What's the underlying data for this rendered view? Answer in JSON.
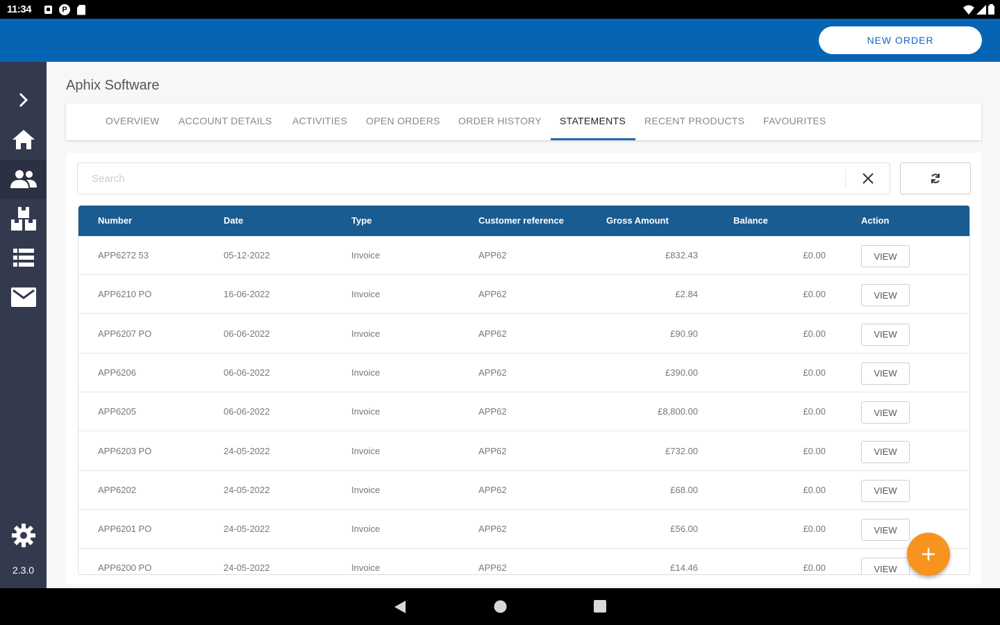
{
  "status_bar": {
    "time": "11:34",
    "notif_letter": "P"
  },
  "header": {
    "new_order_label": "NEW ORDER"
  },
  "sidebar": {
    "items": [
      {
        "name": "expand",
        "icon": "chevron-right-icon"
      },
      {
        "name": "home",
        "icon": "home-icon"
      },
      {
        "name": "customers",
        "icon": "people-icon",
        "active": true
      },
      {
        "name": "products",
        "icon": "boxes-icon"
      },
      {
        "name": "orders",
        "icon": "list-icon"
      },
      {
        "name": "messages",
        "icon": "mail-icon"
      },
      {
        "name": "settings",
        "icon": "gear-icon"
      }
    ],
    "version": "2.3.0"
  },
  "company_name": "Aphix Software",
  "tabs": [
    "OVERVIEW",
    "ACCOUNT DETAILS",
    "ACTIVITIES",
    "OPEN ORDERS",
    "ORDER HISTORY",
    "STATEMENTS",
    "RECENT PRODUCTS",
    "FAVOURITES"
  ],
  "active_tab": "STATEMENTS",
  "search": {
    "placeholder": "Search",
    "value": ""
  },
  "table": {
    "columns": [
      "Number",
      "Date",
      "Type",
      "Customer reference",
      "Gross Amount",
      "Balance",
      "Action"
    ],
    "rows": [
      [
        "APP6272 53",
        "05-12-2022",
        "Invoice",
        "APP62",
        "£832.43",
        "£0.00"
      ],
      [
        "APP6210 PO",
        "16-06-2022",
        "Invoice",
        "APP62",
        "£2.84",
        "£0.00"
      ],
      [
        "APP6207 PO",
        "06-06-2022",
        "Invoice",
        "APP62",
        "£90.90",
        "£0.00"
      ],
      [
        "APP6206",
        "06-06-2022",
        "Invoice",
        "APP62",
        "£390.00",
        "£0.00"
      ],
      [
        "APP6205",
        "06-06-2022",
        "Invoice",
        "APP62",
        "£8,800.00",
        "£0.00"
      ],
      [
        "APP6203 PO",
        "24-05-2022",
        "Invoice",
        "APP62",
        "£732.00",
        "£0.00"
      ],
      [
        "APP6202",
        "24-05-2022",
        "Invoice",
        "APP62",
        "£68.00",
        "£0.00"
      ],
      [
        "APP6201 PO",
        "24-05-2022",
        "Invoice",
        "APP62",
        "£56.00",
        "£0.00"
      ],
      [
        "APP6200 PO",
        "24-05-2022",
        "Invoice",
        "APP62",
        "£14.46",
        "£0.00"
      ]
    ],
    "action_label": "VIEW"
  },
  "colors": {
    "primary": "#0565b4",
    "sidebar": "#343a4e",
    "table_header": "#195c91",
    "fab": "#f7931e"
  }
}
